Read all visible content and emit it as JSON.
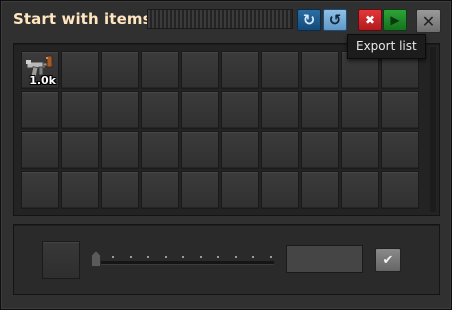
{
  "window": {
    "title": "Start with items"
  },
  "titlebar": {
    "import_icon": "import-string-icon",
    "export_icon": "export-string-icon",
    "delete_icon": "delete-icon",
    "confirm_icon": "play-confirm-icon",
    "close_icon": "close-icon",
    "export_tooltip": "Export list"
  },
  "colors": {
    "title": "#ffe6c0",
    "import_button": "#1f5f91",
    "export_button": "#7aaed8",
    "delete_button": "#d22c2f",
    "confirm_button": "#22892b"
  },
  "grid": {
    "columns": 10,
    "rows": 4,
    "slots": [
      {
        "item_icon": "submachine-gun-icon",
        "count": "1.0k"
      },
      {},
      {},
      {},
      {},
      {},
      {},
      {},
      {},
      {},
      {},
      {},
      {},
      {},
      {},
      {},
      {},
      {},
      {},
      {},
      {},
      {},
      {},
      {},
      {},
      {},
      {},
      {},
      {},
      {},
      {},
      {},
      {},
      {},
      {},
      {},
      {},
      {},
      {},
      {}
    ]
  },
  "editor": {
    "selected_item": "",
    "slider_value": 0,
    "slider_steps": 10,
    "amount_value": "",
    "apply_icon": "check-icon"
  }
}
